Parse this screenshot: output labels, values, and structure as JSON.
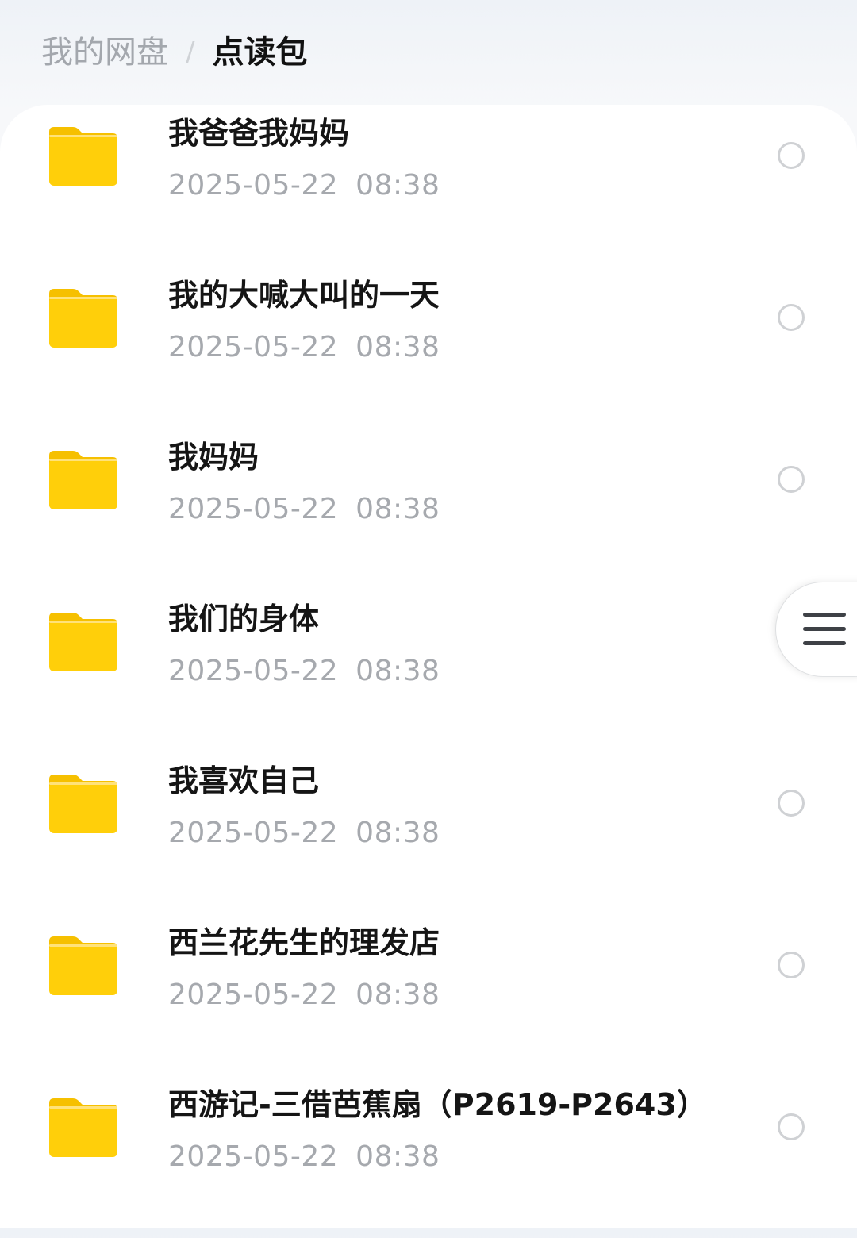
{
  "breadcrumb": {
    "root": "我的网盘",
    "separator": "/",
    "current": "点读包"
  },
  "files": [
    {
      "name": "我爸爸我妈妈",
      "date": "2025-05-22 08:38",
      "icon": "folder-icon"
    },
    {
      "name": "我的大喊大叫的一天",
      "date": "2025-05-22 08:38",
      "icon": "folder-icon"
    },
    {
      "name": "我妈妈",
      "date": "2025-05-22 08:38",
      "icon": "folder-icon"
    },
    {
      "name": "我们的身体",
      "date": "2025-05-22 08:38",
      "icon": "folder-icon"
    },
    {
      "name": "我喜欢自己",
      "date": "2025-05-22 08:38",
      "icon": "folder-icon"
    },
    {
      "name": "西兰花先生的理发店",
      "date": "2025-05-22 08:38",
      "icon": "folder-icon"
    },
    {
      "name": "西游记-三借芭蕉扇（P2619-P2643）",
      "date": "2025-05-22 08:38",
      "icon": "folder-icon"
    }
  ],
  "side_menu": {
    "icon": "menu-icon"
  },
  "colors": {
    "folder_body": "#ffcc00",
    "folder_tab": "#f9c400",
    "title_text": "#151515",
    "date_text": "#a6a9ae",
    "breadcrumb_root": "#a3a7ad"
  }
}
